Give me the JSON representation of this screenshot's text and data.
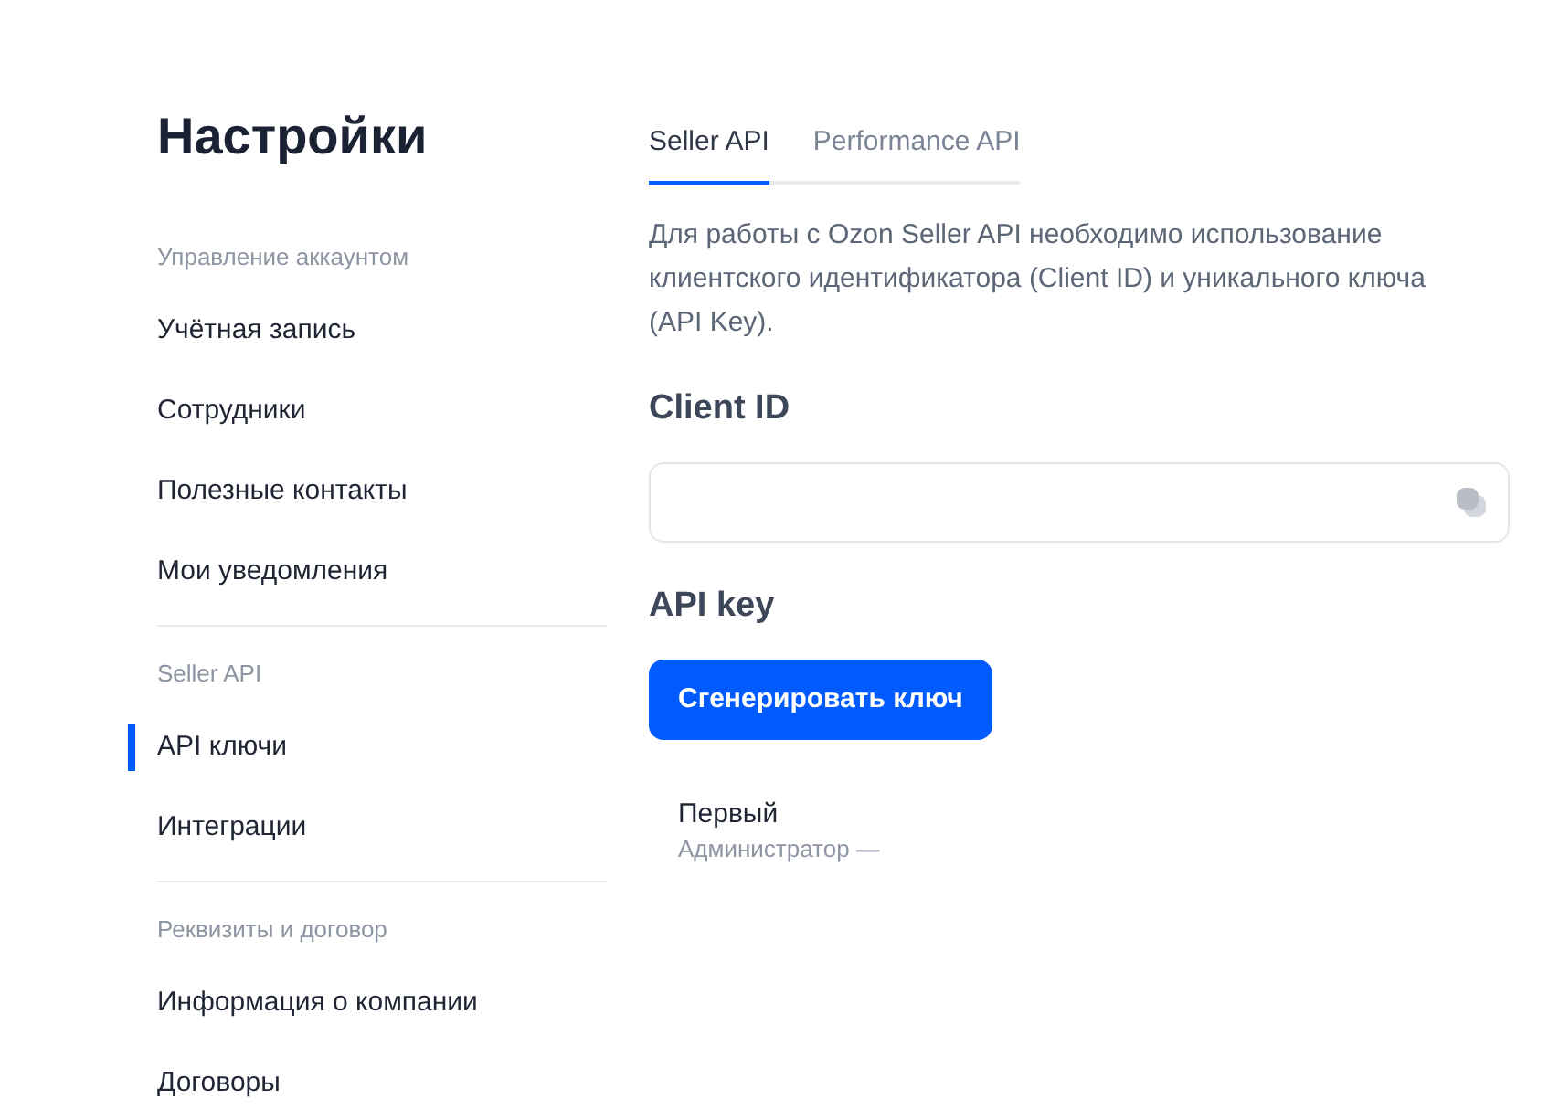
{
  "sidebar": {
    "title": "Настройки",
    "sections": [
      {
        "label": "Управление аккаунтом",
        "items": [
          {
            "label": "Учётная запись",
            "selected": false
          },
          {
            "label": "Сотрудники",
            "selected": false
          },
          {
            "label": "Полезные контакты",
            "selected": false
          },
          {
            "label": "Мои уведомления",
            "selected": false
          }
        ]
      },
      {
        "label": "Seller API",
        "items": [
          {
            "label": "API ключи",
            "selected": true
          },
          {
            "label": "Интеграции",
            "selected": false
          }
        ]
      },
      {
        "label": "Реквизиты и договор",
        "items": [
          {
            "label": "Информация о компании",
            "selected": false
          },
          {
            "label": "Договоры",
            "selected": false
          }
        ]
      }
    ]
  },
  "tabs": [
    {
      "label": "Seller API",
      "selected": true
    },
    {
      "label": "Performance API",
      "selected": false
    }
  ],
  "description": "Для работы с Ozon Seller API необходимо использование клиентского идентификатора (Client ID) и уникального ключа (API Key).",
  "client_id": {
    "heading": "Client ID"
  },
  "api_key": {
    "heading": "API key",
    "button": "Сгенерировать ключ",
    "keys": [
      {
        "name": "Первый",
        "role": "Администратор —"
      }
    ]
  }
}
